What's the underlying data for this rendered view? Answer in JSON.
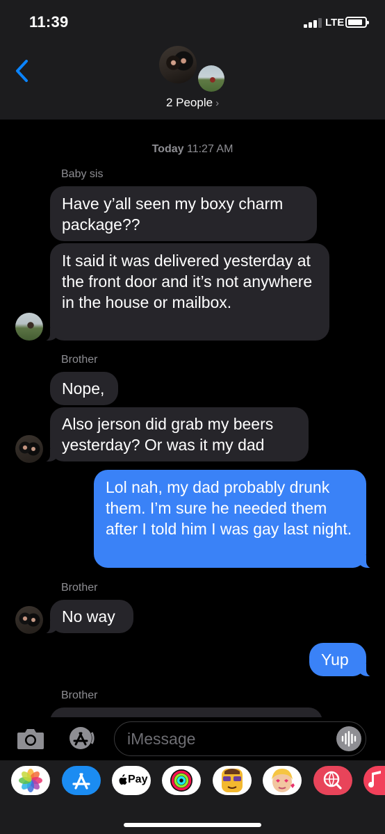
{
  "status_bar": {
    "time": "11:39",
    "network": "LTE",
    "battery_level_fraction": 0.85,
    "signal_bars": 3
  },
  "header": {
    "people_label": "2 People",
    "chevron": "›",
    "back_icon": "chevron-left-icon"
  },
  "conversation": {
    "timestamp_day": "Today",
    "timestamp_time": "11:27 AM",
    "messages": [
      {
        "sender": "Baby sis",
        "direction": "incoming",
        "text": "Have y’all seen my boxy charm package??"
      },
      {
        "sender": "Baby sis",
        "direction": "incoming",
        "text": "It said it was delivered yesterday at the front door and it’s not anywhere in the house or mailbox."
      },
      {
        "sender": "Brother",
        "direction": "incoming",
        "text": "Nope,"
      },
      {
        "sender": "Brother",
        "direction": "incoming",
        "text": "Also jerson did grab my beers yesterday? Or was it my dad"
      },
      {
        "sender": "me",
        "direction": "outgoing",
        "text": "Lol nah, my dad probably drunk them. I’m sure he needed them after I told him I was gay last night."
      },
      {
        "sender": "Brother",
        "direction": "incoming",
        "text": "No way"
      },
      {
        "sender": "me",
        "direction": "outgoing",
        "text": "Yup"
      },
      {
        "sender": "Brother",
        "direction": "incoming",
        "text": ""
      }
    ]
  },
  "sender_labels": [
    "Baby sis",
    "Brother",
    "Brother",
    "Brother"
  ],
  "compose": {
    "placeholder": "iMessage",
    "camera_icon": "camera-icon",
    "apps_icon": "app-store-icon",
    "audio_icon": "waveform-icon"
  },
  "app_drawer": {
    "apps": [
      {
        "name": "Photos",
        "icon": "photos-icon"
      },
      {
        "name": "App Store",
        "icon": "app-store-icon"
      },
      {
        "name": "Apple Pay",
        "label": "Pay",
        "icon": "apple-pay-icon"
      },
      {
        "name": "Activity",
        "icon": "activity-rings-icon"
      },
      {
        "name": "Memoji Stickers",
        "icon": "memoji-sunglasses-icon"
      },
      {
        "name": "Memoji",
        "icon": "memoji-icon"
      },
      {
        "name": "Images",
        "icon": "globe-search-icon"
      },
      {
        "name": "Music",
        "icon": "music-icon"
      }
    ]
  },
  "colors": {
    "incoming_bubble": "#26252a",
    "outgoing_bubble": "#3a82f7",
    "accent": "#0a84ff",
    "background": "#000000",
    "header": "#1c1c1e"
  }
}
